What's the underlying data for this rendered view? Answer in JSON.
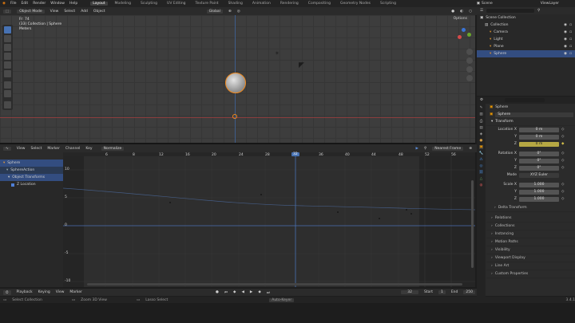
{
  "top_menu": [
    "File",
    "Edit",
    "Render",
    "Window",
    "Help"
  ],
  "workspaces": [
    "Layout",
    "Modeling",
    "Sculpting",
    "UV Editing",
    "Texture Paint",
    "Shading",
    "Animation",
    "Rendering",
    "Compositing",
    "Geometry Nodes",
    "Scripting"
  ],
  "active_workspace": "Layout",
  "scene_label": "Scene",
  "view_layer_label": "ViewLayer",
  "viewport": {
    "mode": "Object Mode",
    "menus": [
      "View",
      "Select",
      "Add",
      "Object"
    ],
    "transform_orientation": "Global",
    "options_label": "Options",
    "overlay_info": [
      "Fr: 74",
      "(33) Collection | Sphere",
      "Meters"
    ]
  },
  "outliner": {
    "header": "Scene Collection",
    "items": [
      {
        "label": "Collection",
        "indent": 1,
        "color": "#cccccc",
        "selected": false
      },
      {
        "label": "Camera",
        "indent": 2,
        "color": "#d8902e",
        "selected": false
      },
      {
        "label": "Light",
        "indent": 2,
        "color": "#d8902e",
        "selected": false
      },
      {
        "label": "Plane",
        "indent": 2,
        "color": "#d8902e",
        "selected": false
      },
      {
        "label": "Sphere",
        "indent": 2,
        "color": "#d8902e",
        "selected": true
      }
    ]
  },
  "properties": {
    "object_name": "Sphere",
    "datablock": "Sphere",
    "section_transform": "Transform",
    "location": {
      "label": "Location X",
      "y": "Y",
      "z": "Z",
      "values": [
        "0 m",
        "0 m",
        "0 m"
      ]
    },
    "rotation": {
      "label": "Rotation X",
      "y": "Y",
      "z": "Z",
      "values": [
        "0°",
        "0°",
        "0°"
      ]
    },
    "mode_label": "Mode",
    "mode_value": "XYZ Euler",
    "scale": {
      "label": "Scale X",
      "y": "Y",
      "z": "Z",
      "values": [
        "1.000",
        "1.000",
        "1.000"
      ]
    },
    "delta": "Delta Transform",
    "panels": [
      "Relations",
      "Collections",
      "Instancing",
      "Motion Paths",
      "Visibility",
      "Viewport Display",
      "Line Art",
      "Custom Properties"
    ]
  },
  "graph_editor": {
    "menus": [
      "View",
      "Select",
      "Marker",
      "Channel",
      "Key"
    ],
    "normalize": "Normalize",
    "pivot": "Nearest Frame",
    "channels": [
      {
        "label": "Sphere",
        "indent": 0,
        "selected": true
      },
      {
        "label": "SphereAction",
        "indent": 1,
        "selected": false
      },
      {
        "label": "Object Transforms",
        "indent": 2,
        "selected": true
      },
      {
        "label": "Z Location",
        "indent": 3,
        "selected": false
      }
    ],
    "frame_ticks": [
      "6",
      "8",
      "12",
      "16",
      "20",
      "24",
      "28",
      "32",
      "36",
      "40",
      "44",
      "48",
      "52",
      "56"
    ],
    "current_frame": "32",
    "y_ticks": [
      "10",
      "5",
      "0",
      "-5",
      "-10"
    ]
  },
  "timeline": {
    "menus": [
      "Playback",
      "Keying",
      "View",
      "Marker"
    ],
    "current": "32",
    "start_label": "Start",
    "start": "1",
    "end_label": "End",
    "end": "250"
  },
  "status": {
    "left": [
      "Select Collection",
      "Zoom 3D View",
      "Lasso Select"
    ],
    "center": "Auto-Keyer",
    "version": "3.4.1"
  }
}
